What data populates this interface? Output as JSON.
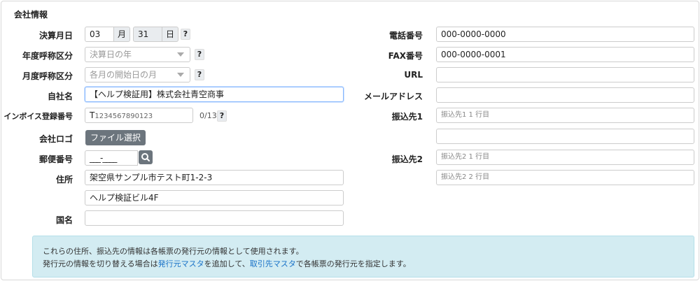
{
  "section_title": "会社情報",
  "left": {
    "settlement_month": {
      "label": "決算月日",
      "month_value": "03",
      "month_unit": "月",
      "day_value": "31",
      "day_unit": "日",
      "help": "?"
    },
    "fiscal_year_label": {
      "label": "年度呼称区分",
      "value": "決算日の年",
      "help": "?"
    },
    "month_label": {
      "label": "月度呼称区分",
      "value": "各月の開始日の月",
      "help": "?"
    },
    "company_name": {
      "label": "自社名",
      "value": "【ヘルプ検証用】株式会社青空商事"
    },
    "invoice_number": {
      "label": "インボイス登録番号",
      "prefix": "T",
      "value": "1234567890123",
      "counter": "0/13",
      "help": "?"
    },
    "logo": {
      "label": "会社ロゴ",
      "button": "ファイル選択"
    },
    "postal_code": {
      "label": "郵便番号",
      "value": "___-____"
    },
    "address": {
      "label": "住所",
      "line1": "架空県サンプル市テスト町1-2-3",
      "line2": "ヘルプ検証ビル4F"
    },
    "country": {
      "label": "国名",
      "value": ""
    }
  },
  "right": {
    "phone": {
      "label": "電話番号",
      "value": "000-0000-0000"
    },
    "fax": {
      "label": "FAX番号",
      "value": "000-0000-0001"
    },
    "url": {
      "label": "URL",
      "value": ""
    },
    "email": {
      "label": "メールアドレス",
      "value": ""
    },
    "bank1": {
      "label": "振込先1",
      "placeholder1": "振込先1 1 行目",
      "placeholder2": ""
    },
    "bank2": {
      "label": "振込先2",
      "placeholder1": "振込先2 1 行目",
      "placeholder2": "振込先2 2 行目"
    }
  },
  "notice": {
    "line1": "これらの住所、振込先の情報は各帳票の発行元の情報として使用されます。",
    "line2_pre": "発行元の情報を切り替える場合は",
    "line2_link1": "発行元マスタ",
    "line2_mid": "を追加して、",
    "line2_link2": "取引先マスタ",
    "line2_post": "で各帳票の発行元を指定します。"
  }
}
